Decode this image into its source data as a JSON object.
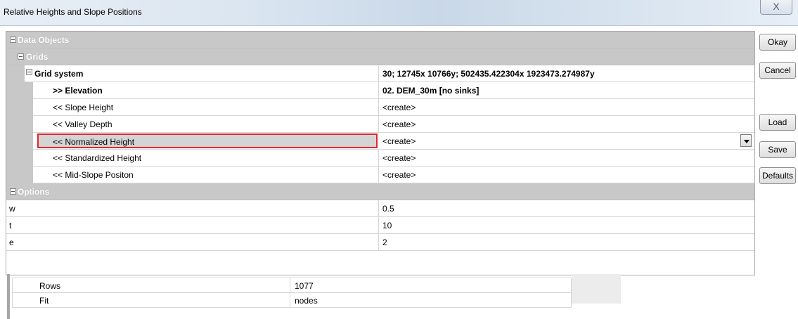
{
  "window": {
    "title": "Relative Heights and Slope Positions",
    "close_glyph": "X"
  },
  "properties": {
    "data_objects_label": "Data Objects",
    "grids_label": "Grids",
    "grid_system": {
      "label": "Grid system",
      "value": "30; 12745x 10766y; 502435.422304x 1923473.274987y"
    },
    "elevation": {
      "label": ">> Elevation",
      "value": "02. DEM_30m [no sinks]"
    },
    "outputs": [
      {
        "label": "<< Slope Height",
        "value": "<create>"
      },
      {
        "label": "<< Valley Depth",
        "value": "<create>"
      },
      {
        "label": "<< Normalized Height",
        "value": "<create>",
        "selected": true
      },
      {
        "label": "<< Standardized Height",
        "value": "<create>"
      },
      {
        "label": "<< Mid-Slope Positon",
        "value": "<create>"
      }
    ],
    "options_label": "Options",
    "options": [
      {
        "label": "w",
        "value": "0.5"
      },
      {
        "label": "t",
        "value": "10"
      },
      {
        "label": "e",
        "value": "2"
      }
    ]
  },
  "buttons": {
    "okay": "Okay",
    "cancel": "Cancel",
    "load": "Load",
    "save": "Save",
    "defaults": "Defaults"
  },
  "lower_table": [
    {
      "label": "Rows",
      "value": "1077"
    },
    {
      "label": "Fit",
      "value": "nodes"
    }
  ],
  "colors": {
    "category_header": "#c8c8c8",
    "selection_border": "#e0282e"
  },
  "icons": {
    "collapse": "minus-box-icon",
    "dropdown": "chevron-down-icon",
    "close": "close-icon"
  }
}
